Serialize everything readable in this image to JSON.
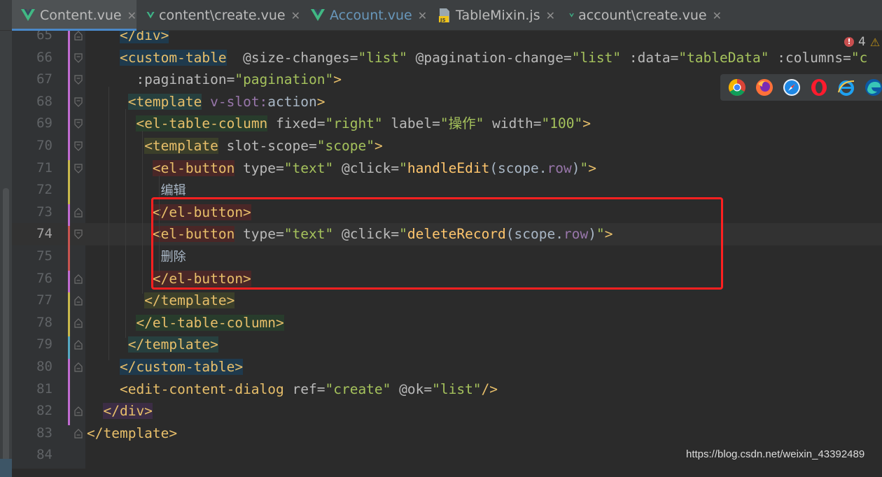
{
  "tabs": [
    {
      "label": "Content.vue",
      "icon": "vue-icon",
      "active": true,
      "color": "#bbbbbb"
    },
    {
      "label": "content\\create.vue",
      "icon": "vue-icon",
      "active": false,
      "color": "#bbbbbb"
    },
    {
      "label": "Account.vue",
      "icon": "vue-icon",
      "active": false,
      "color": "#6897bb"
    },
    {
      "label": "TableMixin.js",
      "icon": "js-file-icon",
      "active": false,
      "color": "#bbbbbb"
    },
    {
      "label": "account\\create.vue",
      "icon": "vue-icon",
      "active": false,
      "color": "#bbbbbb"
    }
  ],
  "tab_close_glyph": "✕",
  "editor": {
    "current_line": 74,
    "lines": [
      {
        "n": "65",
        "code": [
          [
            "    ",
            ""
          ],
          [
            "</div>",
            "tg hl-blue"
          ]
        ]
      },
      {
        "n": "66",
        "code": [
          [
            "    ",
            ""
          ],
          [
            "<custom-table",
            "tg hl-blue"
          ],
          [
            "  @size-changes=",
            "at"
          ],
          [
            "\"list\"",
            "av"
          ],
          [
            " @pagination-change=",
            "at"
          ],
          [
            "\"list\"",
            "av"
          ],
          [
            " :data=",
            "at"
          ],
          [
            "\"tableData\"",
            "av"
          ],
          [
            " :columns=",
            "at"
          ],
          [
            "\"c",
            "av"
          ]
        ]
      },
      {
        "n": "67",
        "code": [
          [
            "      :pagination=",
            "at"
          ],
          [
            "\"pagination\"",
            "av"
          ],
          [
            ">",
            "tg"
          ]
        ]
      },
      {
        "n": "68",
        "code": [
          [
            "     ",
            ""
          ],
          [
            "<template",
            "tg hl-teal"
          ],
          [
            " v-slot:",
            "pp"
          ],
          [
            "action",
            ""
          ],
          [
            ">",
            "tg"
          ]
        ]
      },
      {
        "n": "69",
        "code": [
          [
            "      ",
            ""
          ],
          [
            "<el-table-column",
            "tg hl-green"
          ],
          [
            " fixed=",
            "at"
          ],
          [
            "\"right\"",
            "av"
          ],
          [
            " label=",
            "at"
          ],
          [
            "\"操作\"",
            "av"
          ],
          [
            " width=",
            "at"
          ],
          [
            "\"100\"",
            "av"
          ],
          [
            ">",
            "tg"
          ]
        ]
      },
      {
        "n": "70",
        "code": [
          [
            "       ",
            ""
          ],
          [
            "<template",
            "tg hl-olive"
          ],
          [
            " slot-scope=",
            "at"
          ],
          [
            "\"scope\"",
            "av"
          ],
          [
            ">",
            "tg"
          ]
        ]
      },
      {
        "n": "71",
        "code": [
          [
            "        ",
            ""
          ],
          [
            "<el-button",
            "tg hl-red"
          ],
          [
            " type=",
            "at"
          ],
          [
            "\"text\"",
            "av"
          ],
          [
            " @click=",
            "at"
          ],
          [
            "\"",
            "av"
          ],
          [
            "handleEdit",
            "ev"
          ],
          [
            "(scope.",
            ""
          ],
          [
            "row",
            "pp"
          ],
          [
            ")",
            ""
          ],
          [
            "\"",
            "av"
          ],
          [
            ">",
            "tg"
          ]
        ]
      },
      {
        "n": "72",
        "code": [
          [
            "         ",
            ""
          ],
          [
            "编辑",
            "tx"
          ]
        ]
      },
      {
        "n": "73",
        "code": [
          [
            "        ",
            ""
          ],
          [
            "</el-button>",
            "tg hl-red"
          ]
        ]
      },
      {
        "n": "74",
        "code": [
          [
            "        ",
            ""
          ],
          [
            "<el-button",
            "tg hl-red"
          ],
          [
            " type=",
            "at"
          ],
          [
            "\"text\"",
            "av"
          ],
          [
            " @click=",
            "at"
          ],
          [
            "\"",
            "av"
          ],
          [
            "deleteRecord",
            "ev"
          ],
          [
            "(scope.",
            ""
          ],
          [
            "row",
            "pp"
          ],
          [
            ")",
            ""
          ],
          [
            "\"",
            "av"
          ],
          [
            ">",
            "tg"
          ]
        ]
      },
      {
        "n": "75",
        "code": [
          [
            "         ",
            ""
          ],
          [
            "删除",
            "tx"
          ]
        ]
      },
      {
        "n": "76",
        "code": [
          [
            "        ",
            ""
          ],
          [
            "</el-button>",
            "tg hl-red"
          ]
        ]
      },
      {
        "n": "77",
        "code": [
          [
            "       ",
            ""
          ],
          [
            "</template>",
            "tg hl-olive"
          ]
        ]
      },
      {
        "n": "78",
        "code": [
          [
            "      ",
            ""
          ],
          [
            "</el-table-column>",
            "tg hl-green"
          ]
        ]
      },
      {
        "n": "79",
        "code": [
          [
            "     ",
            ""
          ],
          [
            "</template>",
            "tg hl-teal"
          ]
        ]
      },
      {
        "n": "80",
        "code": [
          [
            "    ",
            ""
          ],
          [
            "</custom-table>",
            "tg hl-blue"
          ]
        ]
      },
      {
        "n": "81",
        "code": [
          [
            "    ",
            ""
          ],
          [
            "<edit-content-dialog",
            "tg"
          ],
          [
            " ref=",
            "at"
          ],
          [
            "\"create\"",
            "av"
          ],
          [
            " @ok=",
            "at"
          ],
          [
            "\"list\"",
            "av"
          ],
          [
            "/>",
            "tg"
          ]
        ]
      },
      {
        "n": "82",
        "code": [
          [
            "  ",
            ""
          ],
          [
            "</div>",
            "tg hl-purple"
          ]
        ]
      },
      {
        "n": "83",
        "code": [
          [
            "</template>",
            "tg"
          ]
        ]
      },
      {
        "n": "84",
        "code": []
      }
    ]
  },
  "error_indicator": {
    "count": "4",
    "error_glyph": "!",
    "warning_glyph": "⚠"
  },
  "browsers": [
    "chrome-icon",
    "firefox-icon",
    "safari-icon",
    "opera-icon",
    "ie-icon",
    "edge-icon"
  ],
  "watermark": "https://blog.csdn.net/weixin_43392489",
  "colors": {
    "accent": "#4a88c7",
    "annotation_box": "#ff2020",
    "tag": "#e8bf6a",
    "attr_value": "#a5c25c"
  }
}
